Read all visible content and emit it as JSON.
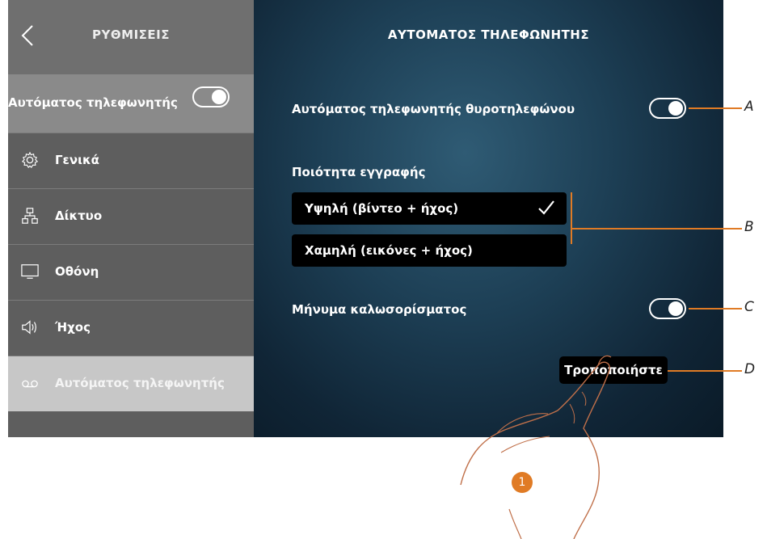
{
  "sidebar": {
    "title": "ΡΥΘΜΙΣΕΙΣ",
    "toggle_label": "Αυτόματος τηλεφωνητής",
    "toggle_on": true,
    "items": [
      {
        "label": "Γενικά",
        "icon": "gear-icon"
      },
      {
        "label": "Δίκτυο",
        "icon": "network-icon"
      },
      {
        "label": "Οθόνη",
        "icon": "monitor-icon"
      },
      {
        "label": "Ήχος",
        "icon": "speaker-icon"
      },
      {
        "label": "Αυτόματος τηλεφωνητής",
        "icon": "voicemail-icon",
        "active": true
      }
    ]
  },
  "main": {
    "title": "ΑΥΤΟΜΑΤΟΣ ΤΗΛΕΦΩΝΗΤΗΣ",
    "door_answering": {
      "label": "Αυτόματος τηλεφωνητής θυροτηλεφώνου",
      "on": true
    },
    "quality": {
      "label": "Ποιότητα εγγραφής",
      "options": [
        {
          "label": "Υψηλή (βίντεο + ήχος)",
          "selected": true
        },
        {
          "label": "Χαμηλή (εικόνες + ήχος)",
          "selected": false
        }
      ]
    },
    "welcome": {
      "label": "Μήνυμα καλωσορίσματος",
      "on": true
    },
    "modify_button": "Τροποποιήστε"
  },
  "callouts": {
    "a": "A",
    "b": "B",
    "c": "C",
    "d": "D"
  },
  "step_number": "1",
  "colors": {
    "accent": "#e07b25",
    "sidebar": "#5e5e5e",
    "main_bg": "#1d3f55"
  }
}
